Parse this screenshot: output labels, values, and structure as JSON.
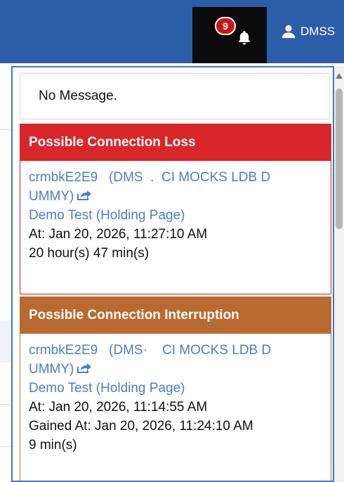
{
  "header": {
    "notification_count": "9",
    "user_label": "DMSS",
    "colors": {
      "bar": "#2b5ea7",
      "bell_bg": "#0b0b0b",
      "badge": "#c81717"
    }
  },
  "panel": {
    "empty_message": "No Message.",
    "cards": [
      {
        "title": "Possible Connection Loss",
        "color": "#d8262a",
        "site_line1": "crmbkE2E9   (DMS  .  CI MOCKS LDB D",
        "site_line2": "UMMY)",
        "location": "Demo Test (Holding Page)",
        "at": "At: Jan 20, 2026, 11:27:10 AM",
        "duration": "20 hour(s) 47 min(s)"
      },
      {
        "title": "Possible Connection Interruption",
        "color": "#b86a31",
        "site_line1": "crmbkE2E9   (DMS·    CI MOCKS LDB D",
        "site_line2": "UMMY)",
        "location": "Demo Test (Holding Page)",
        "at": "At: Jan 20, 2026, 11:14:55 AM",
        "gained": "Gained At: Jan 20, 2026, 11:24:10 AM",
        "duration": "9 min(s)"
      }
    ]
  }
}
